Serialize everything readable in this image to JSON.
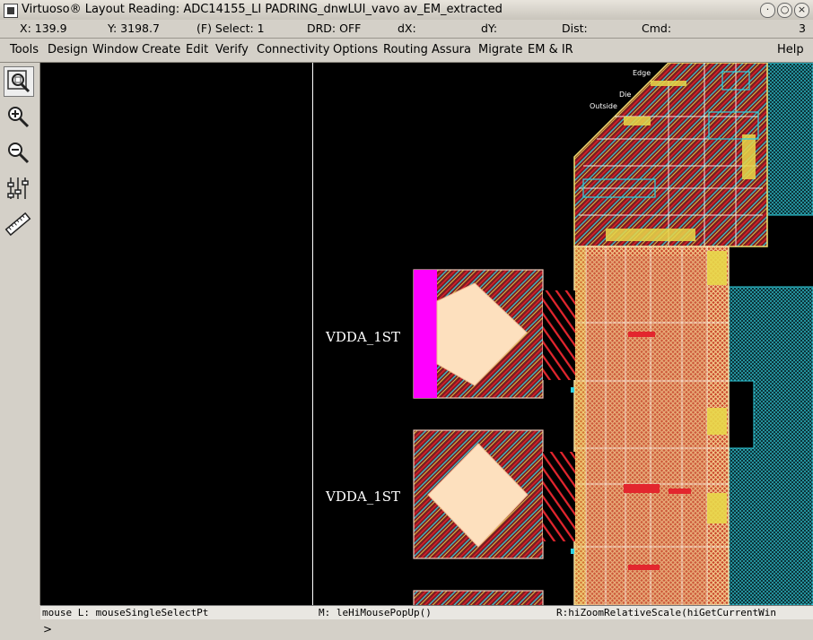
{
  "window": {
    "title": "Virtuoso® Layout Reading: ADC14155_LI PADRING_dnwLUI_vavo av_EM_extracted",
    "controls": [
      "minimize",
      "maximize",
      "close"
    ]
  },
  "status": {
    "x": "X:  139.9",
    "y": "Y:  3198.7",
    "select": "(F) Select: 1",
    "drd": "DRD: OFF",
    "dx": "dX:",
    "dy": "dY:",
    "dist": "Dist:",
    "cmd": "Cmd:",
    "count": "3"
  },
  "menu": {
    "items": [
      "Tools",
      "Design",
      "Window",
      "Create",
      "Edit",
      "Verify",
      "Connectivity",
      "Options",
      "Routing",
      "Assura",
      "Migrate",
      "EM & IR"
    ],
    "help": "Help"
  },
  "toolbar": {
    "icons": [
      "zoom-fit-icon",
      "zoom-in-icon",
      "zoom-out-icon",
      "stretch-icon",
      "ruler-icon"
    ]
  },
  "layout": {
    "pad_labels": [
      "VDDA_1ST",
      "VDDA_1ST"
    ],
    "corner_labels": [
      "Edge",
      "Die",
      "Outside"
    ],
    "colors": {
      "background": "#000000",
      "metal_red": "#d8202a",
      "metal_yellow": "#e8d84a",
      "cyan": "#30d0e0",
      "magenta": "#ff00ff",
      "pad_fill": "#fde0be"
    }
  },
  "mouse": {
    "left": "mouse L: mouseSingleSelectPt",
    "middle": "M: leHiMousePopUp()",
    "right": "R:hiZoomRelativeScale(hiGetCurrentWin"
  },
  "prompt": ">"
}
